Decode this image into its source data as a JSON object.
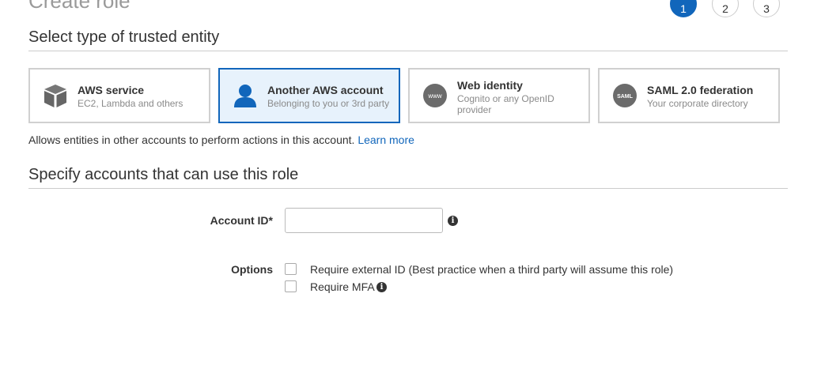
{
  "page": {
    "title": "Create role"
  },
  "steps": [
    {
      "label": "1",
      "active": true
    },
    {
      "label": "2",
      "active": false
    },
    {
      "label": "3",
      "active": false
    }
  ],
  "trusted_entity": {
    "header": "Select type of trusted entity",
    "cards": [
      {
        "title": "AWS service",
        "subtitle": "EC2, Lambda and others",
        "icon": "cube-icon",
        "selected": false
      },
      {
        "title": "Another AWS account",
        "subtitle": "Belonging to you or 3rd party",
        "icon": "user-icon",
        "selected": true
      },
      {
        "title": "Web identity",
        "subtitle": "Cognito or any OpenID provider",
        "icon": "www-icon",
        "icon_text": "www",
        "selected": false
      },
      {
        "title": "SAML 2.0 federation",
        "subtitle": "Your corporate directory",
        "icon": "saml-icon",
        "icon_text": "SAML",
        "selected": false
      }
    ],
    "description": "Allows entities in other accounts to perform actions in this account.",
    "learn_more": "Learn more"
  },
  "accounts": {
    "header": "Specify accounts that can use this role",
    "account_id_label": "Account ID*",
    "account_id_value": "",
    "options_label": "Options",
    "options": [
      {
        "label": "Require external ID (Best practice when a third party will assume this role)",
        "checked": false
      },
      {
        "label": "Require MFA",
        "checked": false
      }
    ]
  },
  "colors": {
    "accent": "#1166bb",
    "selected_card_bg": "#e7f2fc",
    "icon_gray": "#666666"
  }
}
